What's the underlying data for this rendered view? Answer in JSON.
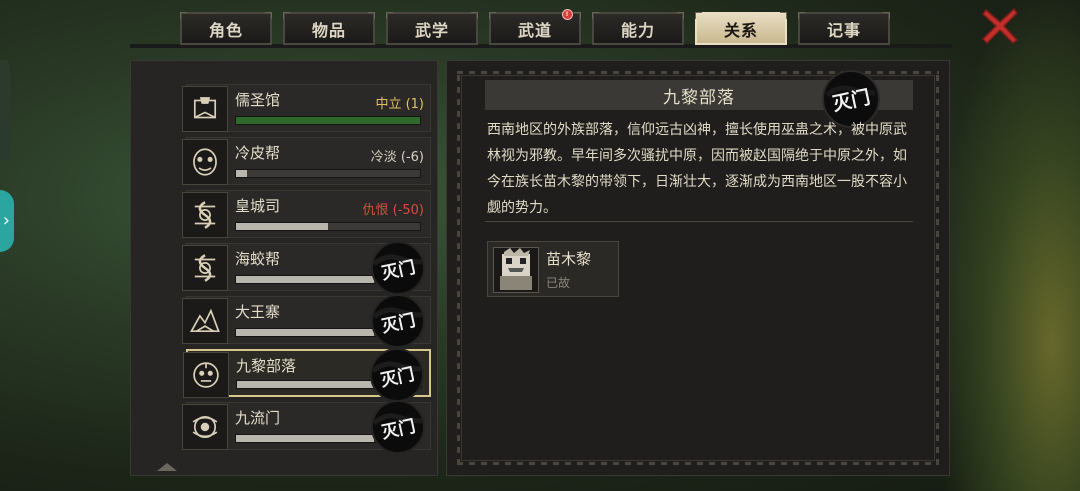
{
  "tabs": [
    {
      "label": "角色",
      "active": false,
      "badge": false
    },
    {
      "label": "物品",
      "active": false,
      "badge": false
    },
    {
      "label": "武学",
      "active": false,
      "badge": false
    },
    {
      "label": "武道",
      "active": false,
      "badge": true
    },
    {
      "label": "能力",
      "active": false,
      "badge": false
    },
    {
      "label": "关系",
      "active": true,
      "badge": false
    },
    {
      "label": "记事",
      "active": false,
      "badge": false
    }
  ],
  "close_icon": "close-x-icon",
  "factions": [
    {
      "name": "儒圣馆",
      "status": "中立 (1)",
      "status_color": "#e0c060",
      "bar_fill": 1.0,
      "bar_color": "#2f6a2a",
      "destroyed": false,
      "selected": false,
      "icon": "book-emblem-icon"
    },
    {
      "name": "冷皮帮",
      "status": "冷淡 (-6)",
      "status_color": "#d8d2c2",
      "bar_fill": 0.06,
      "bar_color": "#b9b6ae",
      "destroyed": false,
      "selected": false,
      "icon": "mask-emblem-icon"
    },
    {
      "name": "皇城司",
      "status": "仇恨 (-50)",
      "status_color": "#d05040",
      "bar_fill": 0.5,
      "bar_color": "#b9b6ae",
      "destroyed": false,
      "selected": false,
      "icon": "serpent-emblem-icon"
    },
    {
      "name": "海蛟帮",
      "status": "",
      "status_color": "#d8d2c2",
      "bar_fill": 0.75,
      "bar_color": "#b9b6ae",
      "destroyed": true,
      "selected": false,
      "icon": "serpent-emblem-icon"
    },
    {
      "name": "大王寨",
      "status": "",
      "status_color": "#d8d2c2",
      "bar_fill": 0.75,
      "bar_color": "#b9b6ae",
      "destroyed": true,
      "selected": false,
      "icon": "mountain-emblem-icon"
    },
    {
      "name": "九黎部落",
      "status": "",
      "status_color": "#d8d2c2",
      "bar_fill": 0.75,
      "bar_color": "#b9b6ae",
      "destroyed": true,
      "selected": true,
      "icon": "totem-emblem-icon"
    },
    {
      "name": "九流门",
      "status": "",
      "status_color": "#d8d2c2",
      "bar_fill": 0.75,
      "bar_color": "#b9b6ae",
      "destroyed": true,
      "selected": false,
      "icon": "orb-emblem-icon"
    }
  ],
  "destroyed_stamp_text": "灭门",
  "detail": {
    "title": "九黎部落",
    "description": "西南地区的外族部落，信仰远古凶神，擅长使用巫蛊之术，被中原武林视为邪教。早年间多次骚扰中原，因而被赵国隔绝于中原之外，如今在族长苗木黎的带领下，日渐壮大，逐渐成为西南地区一股不容小觑的势力。",
    "member": {
      "name": "苗木黎",
      "status": "已故"
    }
  }
}
